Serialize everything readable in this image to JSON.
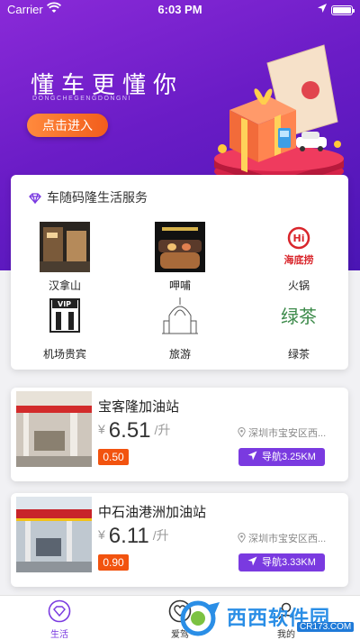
{
  "status_bar": {
    "carrier": "Carrier",
    "time": "6:03 PM"
  },
  "banner": {
    "slogan": "懂车更懂你",
    "subtitle": "DONGCHEGENGDONGNI",
    "enter_button": "点击进入"
  },
  "services": {
    "title": "车随码隆生活服务",
    "items": [
      {
        "label": "汉拿山",
        "icon": "restaurant-photo"
      },
      {
        "label": "呷哺",
        "icon": "hotpot-photo"
      },
      {
        "label": "火锅",
        "icon": "haidilao-logo",
        "logo_text": "海底捞"
      },
      {
        "label": "机场贵宾",
        "icon": "vip-lounge-logo",
        "logo_text": "VIP"
      },
      {
        "label": "旅游",
        "icon": "cathedral-sketch"
      },
      {
        "label": "绿茶",
        "icon": "lvcha-logo",
        "logo_text": "绿茶"
      }
    ]
  },
  "stations": [
    {
      "name": "宝客隆加油站",
      "currency": "¥",
      "price": "6.51",
      "unit": "/升",
      "discount": "0.50",
      "address": "深圳市宝安区西...",
      "nav": "导航3.25KM"
    },
    {
      "name": "中石油港洲加油站",
      "currency": "¥",
      "price": "6.11",
      "unit": "/升",
      "discount": "0.90",
      "address": "深圳市宝安区西...",
      "nav": "导航3.33KM"
    }
  ],
  "tabbar": {
    "tabs": [
      {
        "label": "生活",
        "active": true
      },
      {
        "label": "爱驾",
        "active": false
      },
      {
        "label": "我的",
        "active": false
      }
    ]
  },
  "watermark": {
    "text": "西西软件园",
    "url": "CR173.COM"
  },
  "colors": {
    "accent": "#7a3ae0",
    "orange": "#f2530f",
    "hero_start": "#8a2ad8",
    "hero_end": "#4a15b4"
  }
}
